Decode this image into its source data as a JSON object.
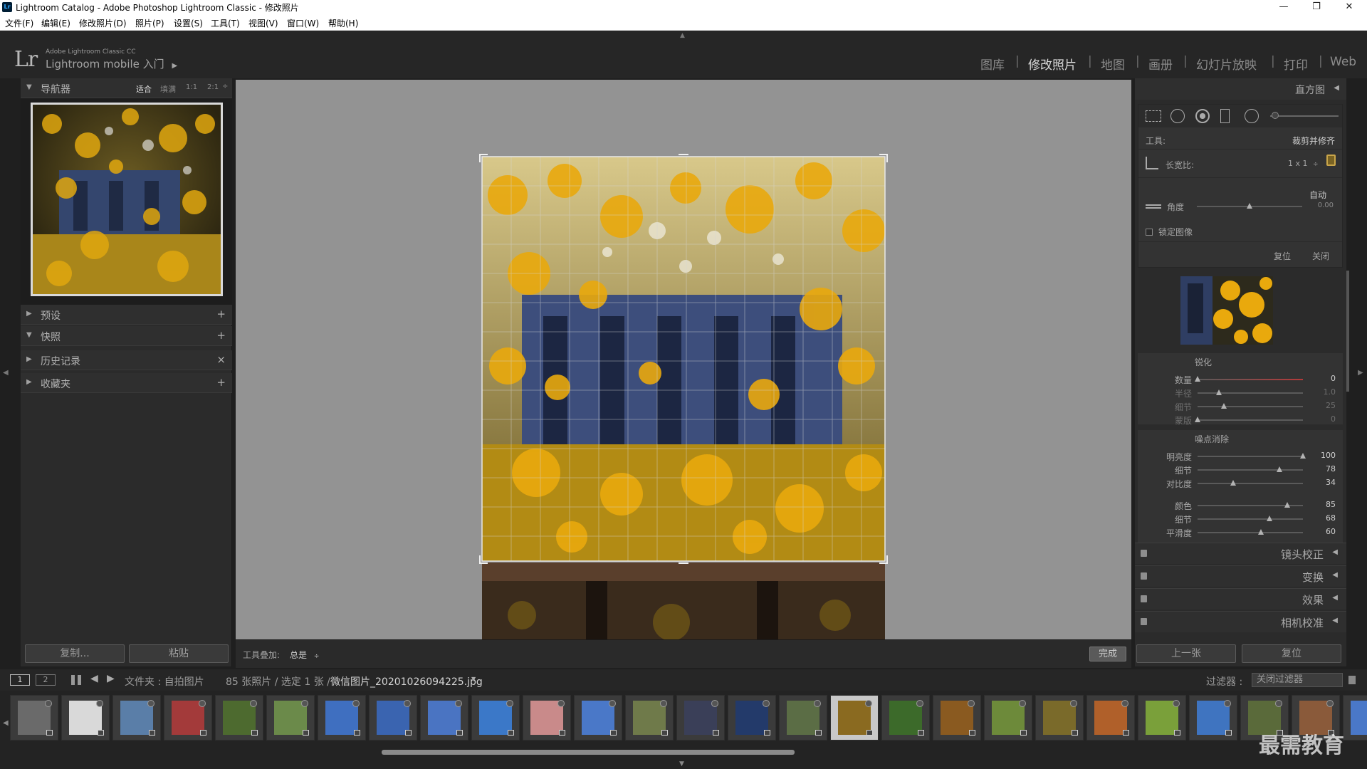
{
  "window": {
    "title": "Lightroom Catalog - Adobe Photoshop Lightroom Classic - 修改照片",
    "app_badge": "Lr",
    "controls": {
      "minimize": "—",
      "maximize": "❐",
      "close": "✕"
    }
  },
  "menu": [
    "文件(F)",
    "编辑(E)",
    "修改照片(D)",
    "照片(P)",
    "设置(S)",
    "工具(T)",
    "视图(V)",
    "窗口(W)",
    "帮助(H)"
  ],
  "identity": {
    "logo": "Lr",
    "product_name": "Adobe Lightroom Classic CC",
    "mobile_label": "Lightroom mobile",
    "get_started": "入门",
    "arrow": "▶"
  },
  "modules": [
    {
      "label": "图库",
      "active": false
    },
    {
      "label": "修改照片",
      "active": true
    },
    {
      "label": "地图",
      "active": false
    },
    {
      "label": "画册",
      "active": false
    },
    {
      "label": "幻灯片放映",
      "active": false
    },
    {
      "label": "打印",
      "active": false
    },
    {
      "label": "Web",
      "active": false
    }
  ],
  "navigator": {
    "title": "导航器",
    "zoom": [
      "适合",
      "填满",
      "1:1",
      "2:1"
    ],
    "zoom_arrow": "÷"
  },
  "left_panels": [
    {
      "label": "预设",
      "action": "+"
    },
    {
      "label": "快照",
      "action": "+"
    },
    {
      "label": "历史记录",
      "action": "×"
    },
    {
      "label": "收藏夹",
      "action": "+"
    }
  ],
  "left_buttons": {
    "copy": "复制...",
    "paste": "粘贴"
  },
  "toolbar": {
    "overlay_label": "工具叠加:",
    "overlay_value": "总是",
    "done": "完成"
  },
  "right_panel": {
    "histogram": "直方图",
    "crop": {
      "tool_label": "工具:",
      "tool_value": "裁剪并修齐",
      "aspect_label": "长宽比:",
      "aspect_value": "1 x 1",
      "auto": "自动",
      "angle_label": "角度",
      "angle_value": "0.00",
      "angle_pct": 0.5,
      "constrain_label": "锁定图像",
      "reset": "复位",
      "close": "关闭"
    },
    "sharpening": {
      "title": "锐化",
      "sliders": [
        {
          "label": "数量",
          "value": "0",
          "pct": 0.0,
          "dim": false
        },
        {
          "label": "半径",
          "value": "1.0",
          "pct": 0.2,
          "dim": true
        },
        {
          "label": "细节",
          "value": "25",
          "pct": 0.25,
          "dim": true
        },
        {
          "label": "蒙版",
          "value": "0",
          "pct": 0.0,
          "dim": true
        }
      ]
    },
    "noise": {
      "title": "噪点消除",
      "sliders": [
        {
          "label": "明亮度",
          "value": "100",
          "pct": 1.0
        },
        {
          "label": "细节",
          "value": "78",
          "pct": 0.78
        },
        {
          "label": "对比度",
          "value": "34",
          "pct": 0.34
        },
        {
          "label": "颜色",
          "value": "85",
          "pct": 0.85
        },
        {
          "label": "细节",
          "value": "68",
          "pct": 0.68
        },
        {
          "label": "平滑度",
          "value": "60",
          "pct": 0.6
        }
      ]
    },
    "sections": [
      "镜头校正",
      "变换",
      "效果",
      "相机校准"
    ],
    "prev_button": "上一张",
    "reset_button": "复位"
  },
  "filmstrip_bar": {
    "page1": "1",
    "page2": "2",
    "source": "文件夹 : 自拍图片",
    "count": "85 张照片 / 选定 1 张 /",
    "filename": "微信图片_20201026094225.jpg",
    "filter_label": "过滤器 :",
    "filter_value": "关闭过滤器"
  },
  "watermark": "最需教育",
  "colors": {
    "accent_red": "#b33a3a",
    "panel_bg": "#2b2b2b",
    "canvas_bg": "#939393"
  }
}
